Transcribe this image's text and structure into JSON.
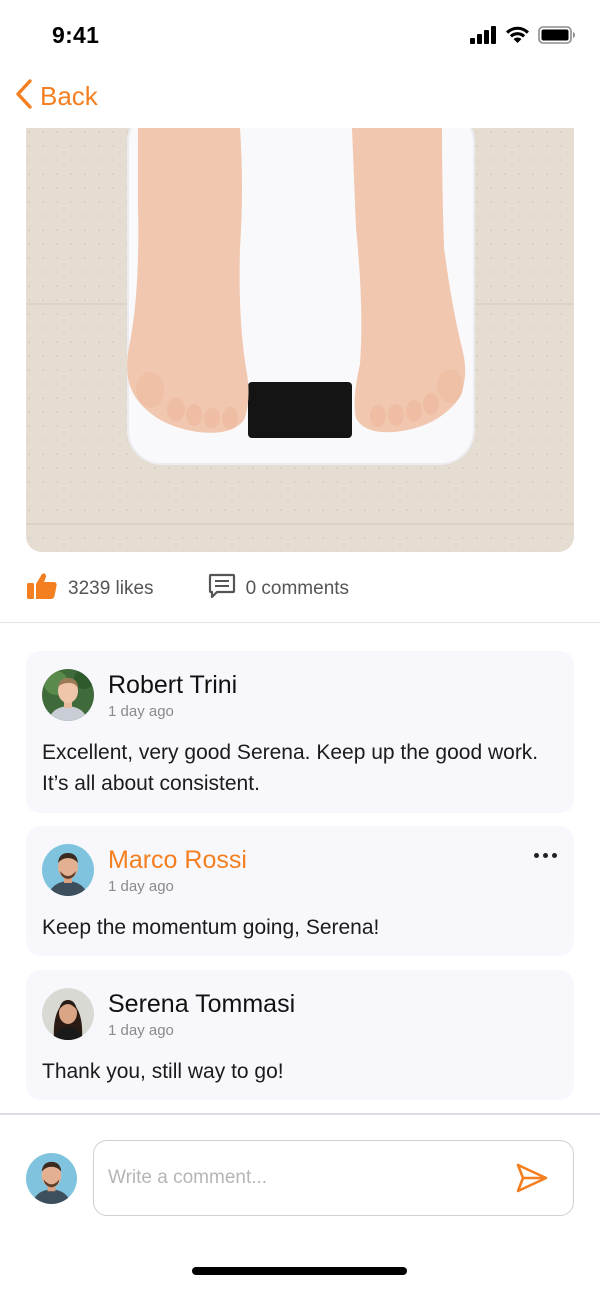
{
  "status_bar": {
    "time": "9:41",
    "icons": [
      "cellular-signal-icon",
      "wifi-icon",
      "battery-icon"
    ]
  },
  "nav": {
    "back_label": "Back",
    "back_icon": "chevron-left-icon"
  },
  "post": {
    "image_description_icon": "photo",
    "likes_icon": "thumbs-up-icon",
    "likes_label": "3239 likes",
    "comments_icon": "comment-icon",
    "comments_label": "0 comments"
  },
  "comments": [
    {
      "author": "Robert Trini",
      "time": "1 day ago",
      "text": "Excellent, very good Serena. Keep up the good work. It’s all about consistent.",
      "highlighted": false
    },
    {
      "author": "Marco Rossi",
      "time": "1 day ago",
      "text": "Keep the momentum going, Serena!",
      "highlighted": true,
      "more_icon": "more-horizontal-icon"
    },
    {
      "author": "Serena Tommasi",
      "time": "1 day ago",
      "text": "Thank you, still way to go!",
      "highlighted": false
    }
  ],
  "composer": {
    "placeholder": "Write a comment...",
    "value": "",
    "send_icon": "send-icon"
  },
  "colors": {
    "accent": "#f47f20",
    "card_bg": "#f8f8fc",
    "muted_text": "#8a8a8a"
  }
}
